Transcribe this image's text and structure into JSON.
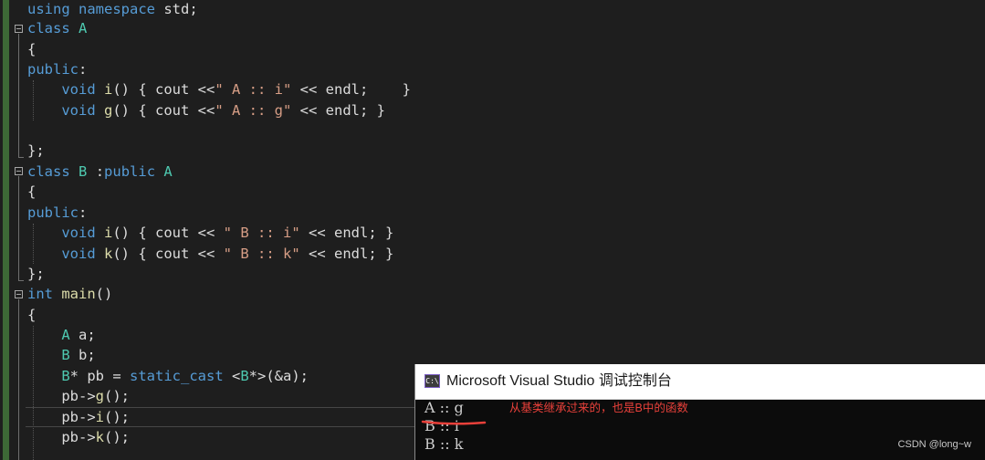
{
  "editor": {
    "lines": [
      [
        [
          "kw",
          "using"
        ],
        [
          "tx",
          " "
        ],
        [
          "kw",
          "namespace"
        ],
        [
          "tx",
          " std;"
        ]
      ],
      [
        [
          "kw",
          "class"
        ],
        [
          "tx",
          " "
        ],
        [
          "ty",
          "A"
        ]
      ],
      [
        [
          "tx",
          "{"
        ]
      ],
      [
        [
          "kw",
          "public"
        ],
        [
          "tx",
          ":"
        ]
      ],
      [
        [
          "tx",
          "    "
        ],
        [
          "kw",
          "void"
        ],
        [
          "tx",
          " "
        ],
        [
          "fn",
          "i"
        ],
        [
          "tx",
          "() { cout <<"
        ],
        [
          "st",
          "\" A :: i\""
        ],
        [
          "tx",
          " << endl;    }"
        ]
      ],
      [
        [
          "tx",
          "    "
        ],
        [
          "kw",
          "void"
        ],
        [
          "tx",
          " "
        ],
        [
          "fn",
          "g"
        ],
        [
          "tx",
          "() { cout <<"
        ],
        [
          "st",
          "\" A :: g\""
        ],
        [
          "tx",
          " << endl; }"
        ]
      ],
      [],
      [
        [
          "tx",
          "};"
        ]
      ],
      [
        [
          "kw",
          "class"
        ],
        [
          "tx",
          " "
        ],
        [
          "ty",
          "B"
        ],
        [
          "tx",
          " :"
        ],
        [
          "kw",
          "public"
        ],
        [
          "tx",
          " "
        ],
        [
          "ty",
          "A"
        ]
      ],
      [
        [
          "tx",
          "{"
        ]
      ],
      [
        [
          "kw",
          "public"
        ],
        [
          "tx",
          ":"
        ]
      ],
      [
        [
          "tx",
          "    "
        ],
        [
          "kw",
          "void"
        ],
        [
          "tx",
          " "
        ],
        [
          "fn",
          "i"
        ],
        [
          "tx",
          "() { cout << "
        ],
        [
          "st",
          "\" B :: i\""
        ],
        [
          "tx",
          " << endl; }"
        ]
      ],
      [
        [
          "tx",
          "    "
        ],
        [
          "kw",
          "void"
        ],
        [
          "tx",
          " "
        ],
        [
          "fn",
          "k"
        ],
        [
          "tx",
          "() { cout << "
        ],
        [
          "st",
          "\" B :: k\""
        ],
        [
          "tx",
          " << endl; }"
        ]
      ],
      [
        [
          "tx",
          "};"
        ]
      ],
      [
        [
          "kw",
          "int"
        ],
        [
          "tx",
          " "
        ],
        [
          "fn",
          "main"
        ],
        [
          "tx",
          "()"
        ]
      ],
      [
        [
          "tx",
          "{"
        ]
      ],
      [
        [
          "tx",
          "    "
        ],
        [
          "ty",
          "A"
        ],
        [
          "tx",
          " a;"
        ]
      ],
      [
        [
          "tx",
          "    "
        ],
        [
          "ty",
          "B"
        ],
        [
          "tx",
          " b;"
        ]
      ],
      [
        [
          "tx",
          "    "
        ],
        [
          "ty",
          "B"
        ],
        [
          "tx",
          "* pb = "
        ],
        [
          "kw",
          "static_cast"
        ],
        [
          "tx",
          " <"
        ],
        [
          "ty",
          "B"
        ],
        [
          "tx",
          "*>(&a);"
        ]
      ],
      [
        [
          "tx",
          "    pb->"
        ],
        [
          "fn",
          "g"
        ],
        [
          "tx",
          "();"
        ]
      ],
      [
        [
          "tx",
          "    pb->"
        ],
        [
          "fn",
          "i"
        ],
        [
          "tx",
          "();"
        ]
      ],
      [
        [
          "tx",
          "    pb->"
        ],
        [
          "fn",
          "k"
        ],
        [
          "tx",
          "();"
        ]
      ]
    ]
  },
  "console": {
    "title": "Microsoft Visual Studio 调试控制台",
    "icon_text": "C:\\",
    "output": [
      "A :: g",
      "B :: i",
      "B :: k"
    ],
    "annotation": "从基类继承过来的，也是B中的函数",
    "annotation_color": "#e8403a"
  },
  "watermark": "CSDN @long~w",
  "colors": {
    "keyword": "#569cd6",
    "type": "#4ec9b0",
    "function": "#dcdcaa",
    "string": "#d69d85",
    "text": "#dcdcdc"
  }
}
